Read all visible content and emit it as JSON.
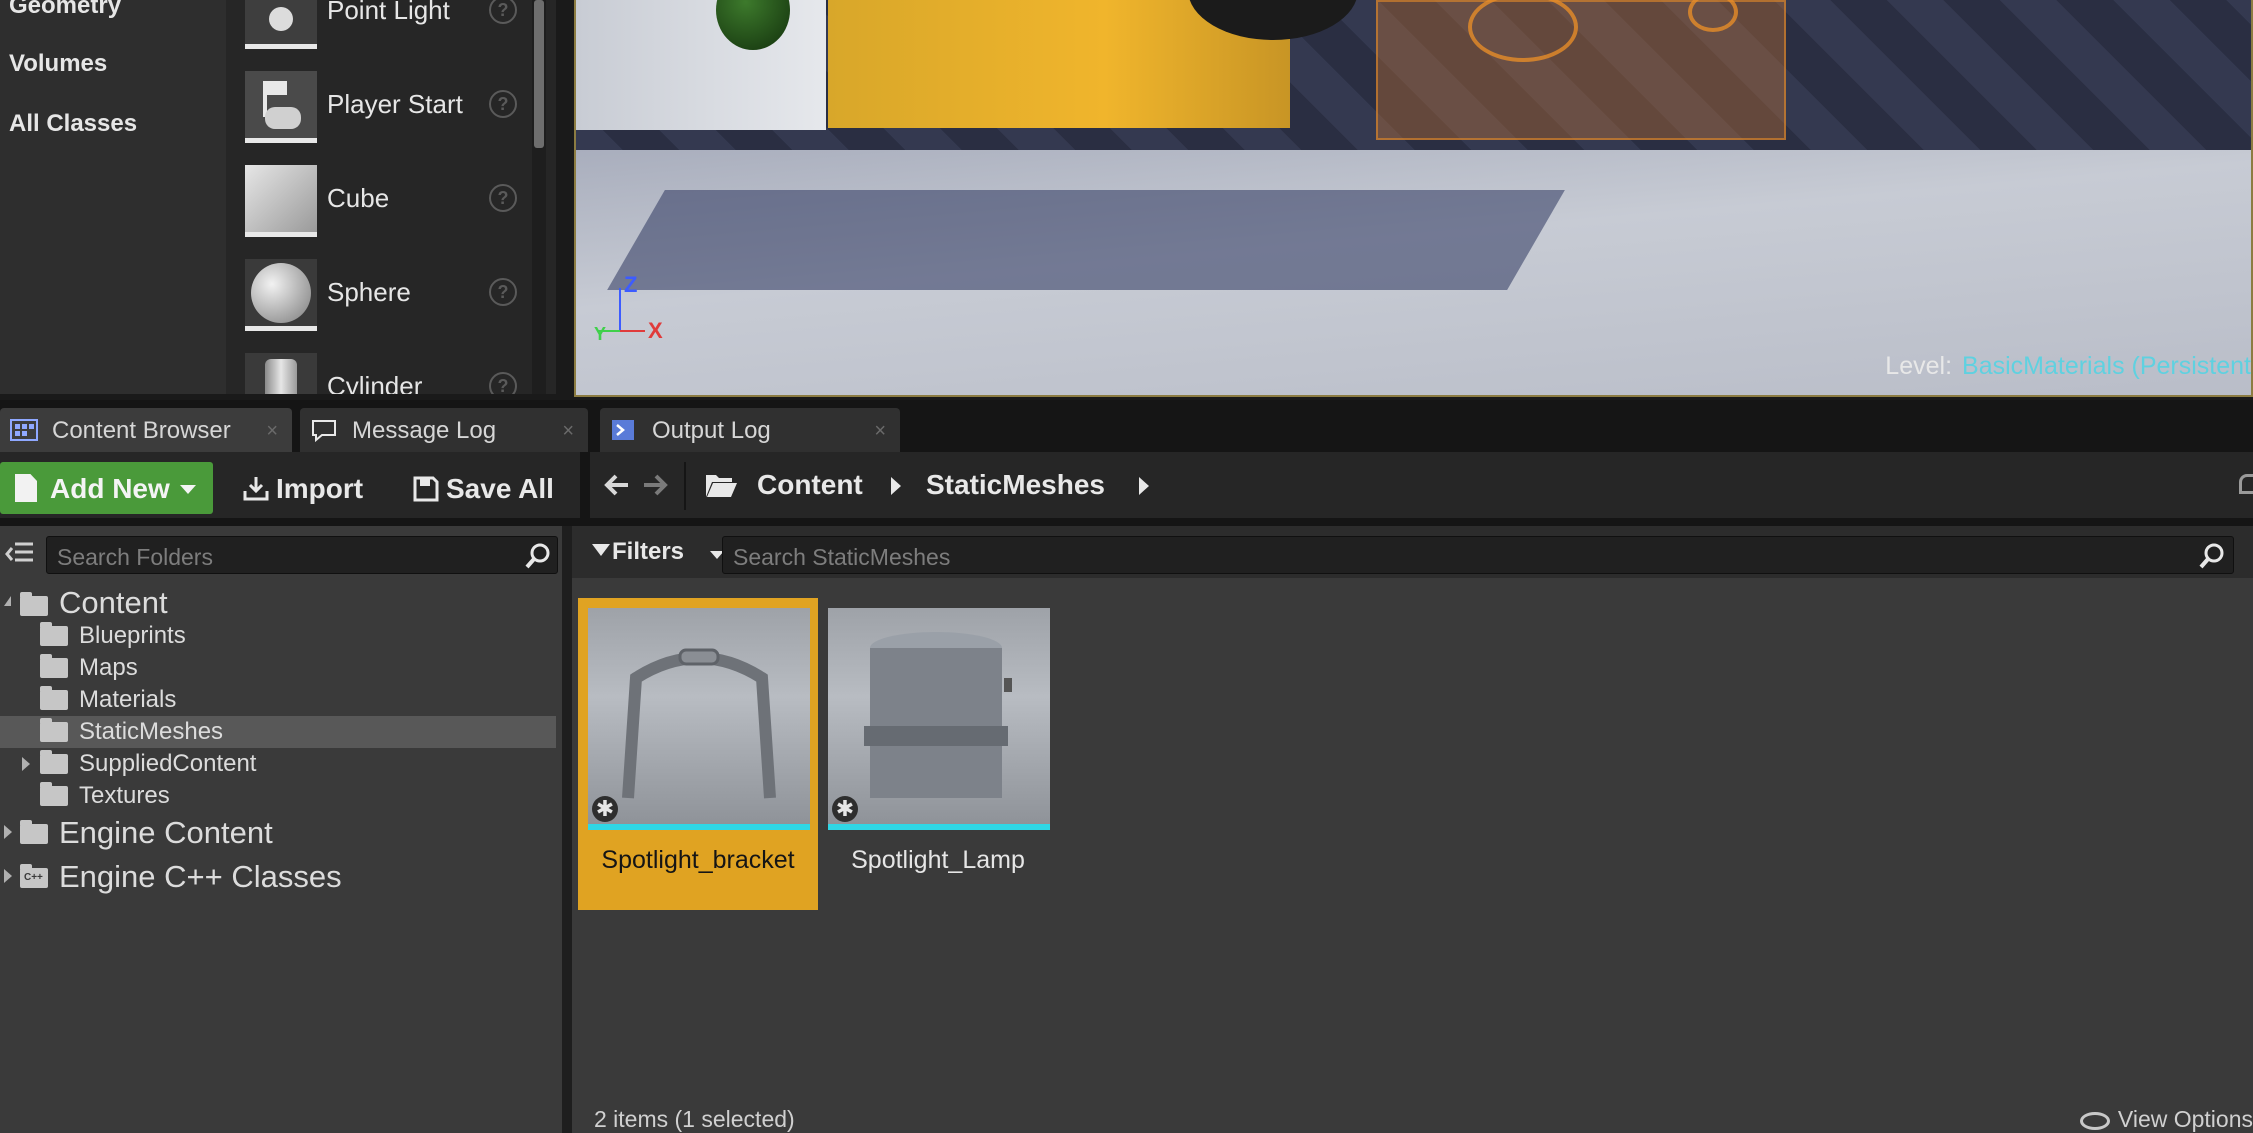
{
  "place_actors": {
    "categories": [
      "Geometry",
      "Volumes",
      "All Classes"
    ],
    "items": [
      {
        "label": "Point Light",
        "icon": "point-light-icon"
      },
      {
        "label": "Player Start",
        "icon": "player-start-icon"
      },
      {
        "label": "Cube",
        "icon": "cube-icon"
      },
      {
        "label": "Sphere",
        "icon": "sphere-icon"
      },
      {
        "label": "Cylinder",
        "icon": "cylinder-icon"
      }
    ],
    "help_glyph": "?"
  },
  "viewport": {
    "axis": {
      "z": "Z",
      "x": "X",
      "y": "Y"
    },
    "level_key": "Level:",
    "level_value": "BasicMaterials (Persistent"
  },
  "tabs": [
    {
      "label": "Content Browser",
      "close": "×",
      "icon": "content-browser-icon",
      "active": true
    },
    {
      "label": "Message Log",
      "close": "×",
      "icon": "message-log-icon",
      "active": false
    },
    {
      "label": "Output Log",
      "close": "×",
      "icon": "output-log-icon",
      "active": false
    }
  ],
  "toolbar": {
    "add_new": "Add New",
    "import": "Import",
    "save_all": "Save All"
  },
  "breadcrumbs": [
    "Content",
    "StaticMeshes"
  ],
  "sources": {
    "search_placeholder": "Search Folders",
    "tree": [
      {
        "label": "Content",
        "level": 0,
        "expanded": true,
        "big": true
      },
      {
        "label": "Blueprints",
        "level": 1
      },
      {
        "label": "Maps",
        "level": 1
      },
      {
        "label": "Materials",
        "level": 1
      },
      {
        "label": "StaticMeshes",
        "level": 1,
        "selected": true
      },
      {
        "label": "SuppliedContent",
        "level": 1,
        "collapsed": true
      },
      {
        "label": "Textures",
        "level": 1
      },
      {
        "label": "Engine Content",
        "level": 0,
        "collapsed": true,
        "big": true
      },
      {
        "label": "Engine C++ Classes",
        "level": 0,
        "collapsed": true,
        "big": true,
        "cpp": true
      }
    ]
  },
  "assets": {
    "filters_label": "Filters",
    "search_placeholder": "Search StaticMeshes",
    "items": [
      {
        "name": "Spotlight_bracket",
        "selected": true
      },
      {
        "name": "Spotlight_Lamp",
        "selected": false
      }
    ],
    "status": "2 items (1 selected)",
    "view_options": "View Options"
  },
  "colors": {
    "accent_selected": "#e0a322",
    "add_new_green": "#4a9a3a",
    "static_mesh_bar": "#2fd7e6",
    "level_value": "#5fd1e0"
  }
}
